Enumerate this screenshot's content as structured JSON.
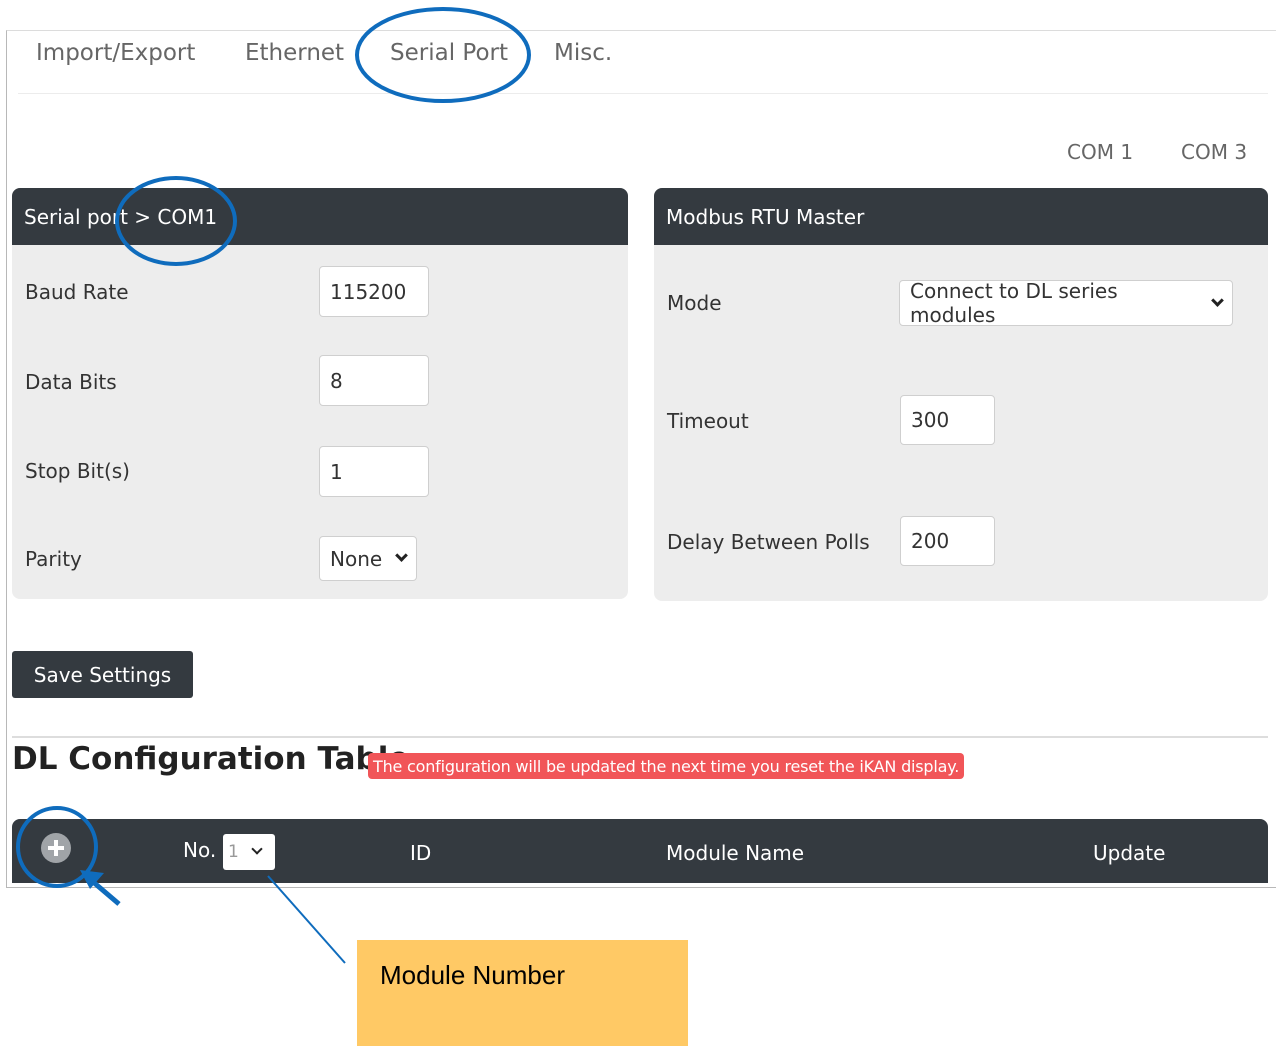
{
  "tabs": [
    "Import/Export",
    "Ethernet",
    "Serial Port",
    "Misc."
  ],
  "com_links": [
    "COM 1",
    "COM 3"
  ],
  "serial_panel": {
    "title": "Serial port > COM1",
    "baud_rate": {
      "label": "Baud Rate",
      "value": "115200"
    },
    "data_bits": {
      "label": "Data Bits",
      "value": "8"
    },
    "stop_bits": {
      "label": "Stop Bit(s)",
      "value": "1"
    },
    "parity": {
      "label": "Parity",
      "value": "None"
    }
  },
  "modbus_panel": {
    "title": "Modbus RTU Master",
    "mode": {
      "label": "Mode",
      "value": "Connect to DL series modules"
    },
    "timeout": {
      "label": "Timeout",
      "value": "300"
    },
    "delay": {
      "label": "Delay Between Polls",
      "value": "200"
    }
  },
  "save_button": "Save Settings",
  "dl_table": {
    "title": "DL Configuration Table",
    "notice": "The configuration will be updated the next time you reset the iKAN display.",
    "columns": {
      "no": "No.",
      "no_value": "1",
      "id": "ID",
      "module_name": "Module Name",
      "update": "Update"
    }
  },
  "annotation": {
    "callout_text": "Module Number",
    "color": "#0f6cbd",
    "callout_bg": "#ffc965"
  }
}
